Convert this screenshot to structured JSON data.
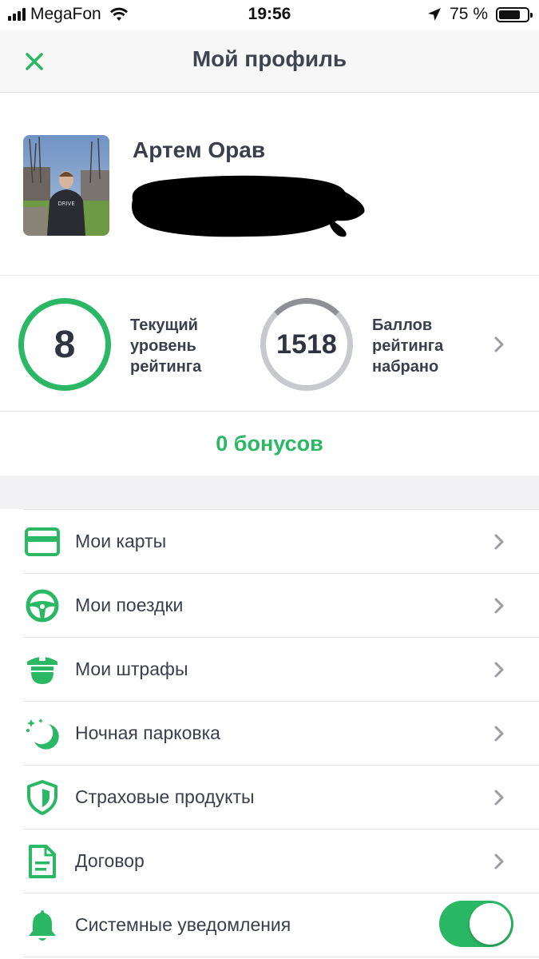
{
  "status_bar": {
    "carrier": "MegaFon",
    "time": "19:56",
    "battery": "75 %",
    "battery_level": 0.75
  },
  "header": {
    "title": "Мой профиль",
    "close_icon": "close-icon"
  },
  "profile": {
    "name": "Артем Орав"
  },
  "rating": {
    "level_value": "8",
    "level_label": "Текущий уровень рейтинга",
    "points_value": "1518",
    "points_label": "Баллов рейтинга набрано"
  },
  "bonuses": "0 бонусов",
  "menu": {
    "items": [
      {
        "label": "Мои карты",
        "icon": "card-icon"
      },
      {
        "label": "Мои поездки",
        "icon": "steering-wheel-icon"
      },
      {
        "label": "Мои штрафы",
        "icon": "police-cap-icon"
      },
      {
        "label": "Ночная парковка",
        "icon": "moon-stars-icon"
      },
      {
        "label": "Страховые продукты",
        "icon": "shield-icon"
      },
      {
        "label": "Договор",
        "icon": "document-icon"
      },
      {
        "label": "Системные уведомления",
        "icon": "bell-icon"
      }
    ],
    "notifications_enabled": true
  },
  "colors": {
    "accent": "#2ab864",
    "text": "#3a3f4b"
  }
}
